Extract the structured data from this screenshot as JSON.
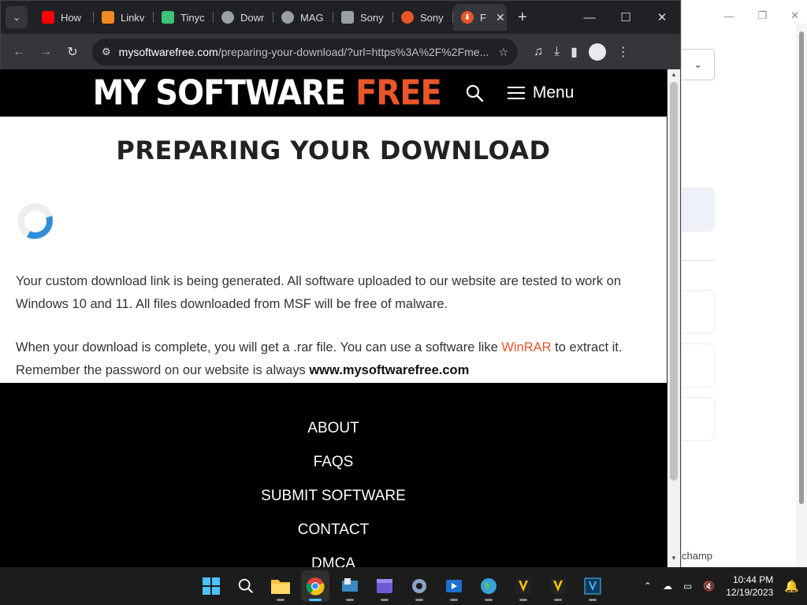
{
  "browser": {
    "tabs": [
      {
        "label": "How",
        "favicon": "youtube-icon",
        "color": "#ff0000"
      },
      {
        "label": "Linkv",
        "favicon": "linkvertise-icon",
        "color": "#f08a24"
      },
      {
        "label": "Tinyc",
        "favicon": "tinyc-icon",
        "color": "#3ec27a"
      },
      {
        "label": "Dowr",
        "favicon": "globe-icon",
        "color": "#9aa0a6"
      },
      {
        "label": "MAG",
        "favicon": "globe-icon",
        "color": "#9aa0a6"
      },
      {
        "label": "Sony",
        "favicon": "bank-icon",
        "color": "#9aa0a6"
      },
      {
        "label": "Sony",
        "favicon": "download-icon",
        "color": "#e8562a"
      }
    ],
    "active_tab": {
      "label": "F",
      "favicon": "download-icon",
      "color": "#e8562a"
    },
    "url_host": "mysoftwarefree.com",
    "url_rest": "/preparing-your-download/?url=https%3A%2F%2Fme..."
  },
  "site": {
    "logo_main": "MY SOFTWARE ",
    "logo_accent": "FREE",
    "menu_label": "Menu",
    "accent_color": "#e8562a"
  },
  "page": {
    "title": "PREPARING YOUR DOWNLOAD",
    "para1": "Your custom download link is being generated. All software uploaded to our website are tested to work on Windows 10 and 11. All files downloaded from MSF will be free of malware.",
    "para2_a": "When your download is complete, you will get a .rar file. You can use a software like ",
    "para2_link": "WinRAR",
    "para2_b": " to extract it. Remember the password on our website is always ",
    "para2_password": "www.mysoftwarefree.com"
  },
  "footer": {
    "links": [
      "ABOUT",
      "FAQS",
      "SUBMIT SOFTWARE",
      "CONTACT",
      "DMCA"
    ]
  },
  "bg_window": {
    "partial_text": "champ"
  },
  "taskbar": {
    "time": "10:44 PM",
    "date": "12/19/2023"
  }
}
